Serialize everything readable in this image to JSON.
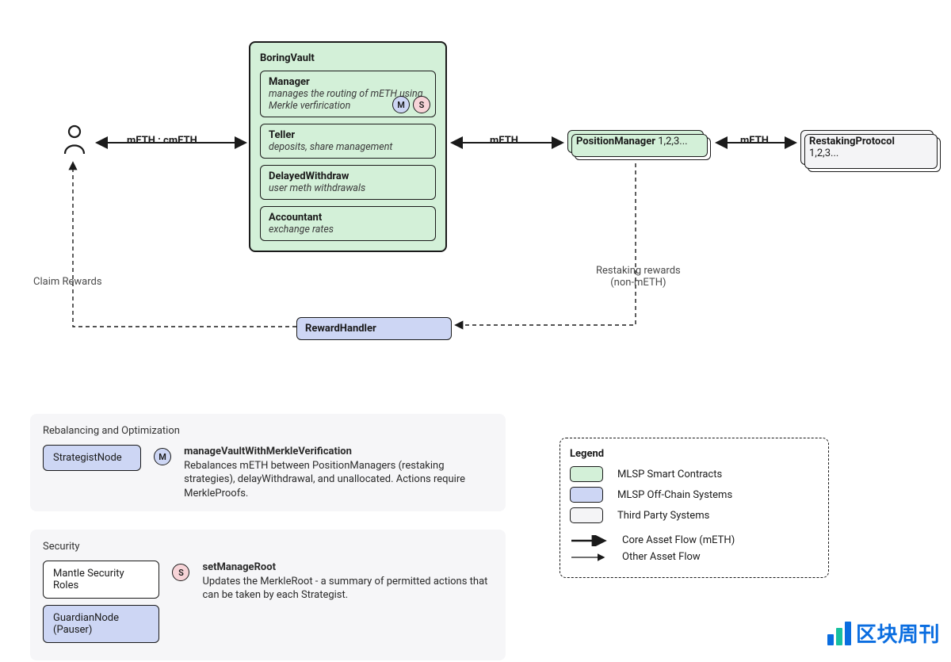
{
  "flow": {
    "user_to_vault_label": "mETH : cmETH",
    "vault_to_pm_label": "mETH",
    "pm_to_rp_label": "mETH",
    "claim_rewards_label": "Claim Rewards",
    "restaking_rewards_label_l1": "Restaking rewards",
    "restaking_rewards_label_l2": "(non-mETH)"
  },
  "vault": {
    "title": "BoringVault",
    "manager_title": "Manager",
    "manager_sub": "manages the routing of mETH using Merkle verfirication",
    "teller_title": "Teller",
    "teller_sub": "deposits, share management",
    "dw_title": "DelayedWithdraw",
    "dw_sub": "user meth withdrawals",
    "acct_title": "Accountant",
    "acct_sub": "exchange rates",
    "badge_m": "M",
    "badge_s": "S"
  },
  "pm": {
    "title": "PositionManager",
    "suffix": " 1,2,3..."
  },
  "rp": {
    "title": "RestakingProtocol",
    "suffix": " 1,2,3..."
  },
  "reward_handler": "RewardHandler",
  "panels": {
    "rebalancing": {
      "title": "Rebalancing and Optimization",
      "node": "StrategistNode",
      "badge": "M",
      "func_title": "manageVaultWithMerkleVerification",
      "func_desc": "Rebalances mETH between PositionManagers (restaking strategies), delayWithdrawal, and unallocated. Actions require MerkleProofs."
    },
    "security": {
      "title": "Security",
      "role1": "Mantle Security Roles",
      "role2": "GuardianNode (Pauser)",
      "badge": "S",
      "func_title": "setManageRoot",
      "func_desc": "Updates the MerkleRoot - a summary of permitted actions that can be taken by each Strategist."
    }
  },
  "legend": {
    "title": "Legend",
    "contracts": "MLSP Smart Contracts",
    "offchain": "MLSP Off-Chain Systems",
    "thirdparty": "Third Party Systems",
    "core_flow": "Core Asset Flow (mETH)",
    "other_flow": "Other Asset Flow"
  },
  "watermark": "区块周刊"
}
